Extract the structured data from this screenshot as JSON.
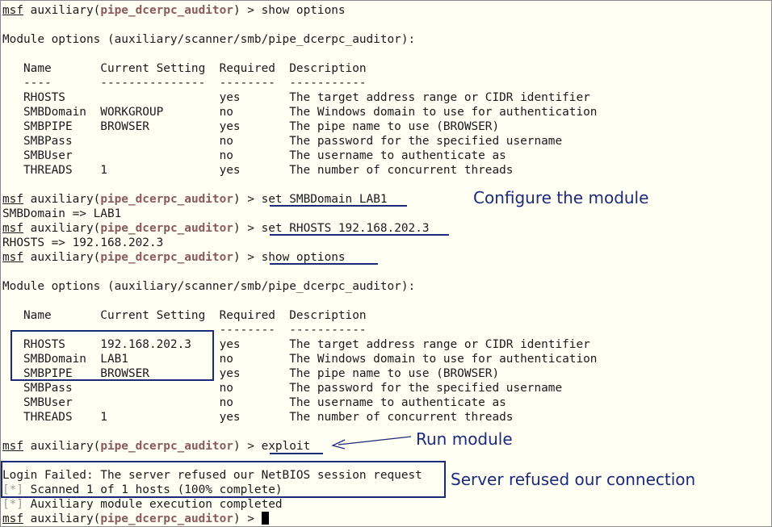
{
  "terminal": {
    "prompt": {
      "msf": "msf",
      "context_prefix": " auxiliary(",
      "module": "pipe_dcerpc_auditor",
      "context_suffix": ") > "
    },
    "cmd1": "show options",
    "options_header": "Module options (auxiliary/scanner/smb/pipe_dcerpc_auditor):",
    "table1": {
      "header": "   Name       Current Setting  Required  Description",
      "rule": "   ----       ---------------  --------  -----------",
      "rows": [
        "   RHOSTS                      yes       The target address range or CIDR identifier",
        "   SMBDomain  WORKGROUP        no        The Windows domain to use for authentication",
        "   SMBPIPE    BROWSER          yes       The pipe name to use (BROWSER)",
        "   SMBPass                     no        The password for the specified username",
        "   SMBUser                     no        The username to authenticate as",
        "   THREADS    1                yes       The number of concurrent threads"
      ]
    },
    "cmd2": "set SMBDomain LAB1",
    "out2": "SMBDomain => LAB1",
    "cmd3": "set RHOSTS 192.168.202.3",
    "out3": "RHOSTS => 192.168.202.3",
    "cmd4": "show options",
    "table2": {
      "header": "   Name       Current Setting  Required  Description",
      "rule": "                               --------  -----------",
      "rows": [
        "   RHOSTS     192.168.202.3    yes       The target address range or CIDR identifier",
        "   SMBDomain  LAB1             no        The Windows domain to use for authentication",
        "   SMBPIPE    BROWSER          yes       The pipe name to use (BROWSER)",
        "   SMBPass                     no        The password for the specified username",
        "   SMBUser                     no        The username to authenticate as",
        "   THREADS    1                yes       The number of concurrent threads"
      ]
    },
    "cmd5": "exploit",
    "out5": "Login Failed: The server refused our NetBIOS session request",
    "status_marker": "[*]",
    "status1": " Scanned 1 of 1 hosts (100% complete)",
    "status2": " Auxiliary module execution completed"
  },
  "annotations": {
    "configure": "Configure the module",
    "run": "Run module",
    "refused": "Server refused our connection",
    "color": "#1c2a7a"
  }
}
